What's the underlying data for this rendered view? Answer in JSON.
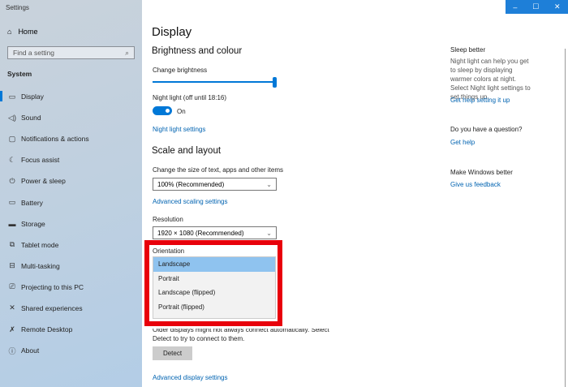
{
  "window": {
    "title": "Settings",
    "controls": [
      "–",
      "☐",
      "✕"
    ]
  },
  "sidebar": {
    "home": "Home",
    "search_placeholder": "Find a setting",
    "section": "System",
    "items": [
      {
        "label": "Display",
        "icon": "▭"
      },
      {
        "label": "Sound",
        "icon": "◁)"
      },
      {
        "label": "Notifications & actions",
        "icon": "▢"
      },
      {
        "label": "Focus assist",
        "icon": "☾"
      },
      {
        "label": "Power & sleep",
        "icon": "⏻"
      },
      {
        "label": "Battery",
        "icon": "▭"
      },
      {
        "label": "Storage",
        "icon": "▬"
      },
      {
        "label": "Tablet mode",
        "icon": "⧉"
      },
      {
        "label": "Multi-tasking",
        "icon": "⊟"
      },
      {
        "label": "Projecting to this PC",
        "icon": "⎚"
      },
      {
        "label": "Shared experiences",
        "icon": "✕"
      },
      {
        "label": "Remote Desktop",
        "icon": "✗"
      },
      {
        "label": "About",
        "icon": "ⓘ"
      }
    ]
  },
  "main": {
    "title": "Display",
    "brightness": {
      "heading": "Brightness and colour",
      "label": "Change brightness",
      "value_percent": 100,
      "night_light_label": "Night light (off until 18:16)",
      "toggle_state": "On",
      "night_light_link": "Night light settings"
    },
    "scale": {
      "heading": "Scale and layout",
      "size_label": "Change the size of text, apps and other items",
      "size_value": "100% (Recommended)",
      "advanced_link": "Advanced scaling settings",
      "resolution_label": "Resolution",
      "resolution_value": "1920 × 1080 (Recommended)",
      "orientation_label": "Orientation",
      "orientation_options": [
        "Landscape",
        "Portrait",
        "Landscape (flipped)",
        "Portrait (flipped)"
      ],
      "orientation_selected": "Landscape"
    },
    "detect_text_1": "Older displays might not always connect automatically. Select",
    "detect_text_2": "Detect to try to connect to them.",
    "detect_button": "Detect",
    "advanced_display_link": "Advanced display settings"
  },
  "right": {
    "sleep_title": "Sleep better",
    "sleep_text": "Night light can help you get to sleep by displaying warmer colors at night. Select Night light settings to set things up.",
    "sleep_link": "Get help setting it up",
    "question_title": "Do you have a question?",
    "question_link": "Get help",
    "feedback_title": "Make Windows better",
    "feedback_link": "Give us feedback"
  },
  "colors": {
    "accent": "#0078d7",
    "highlight": "#e8000b"
  }
}
